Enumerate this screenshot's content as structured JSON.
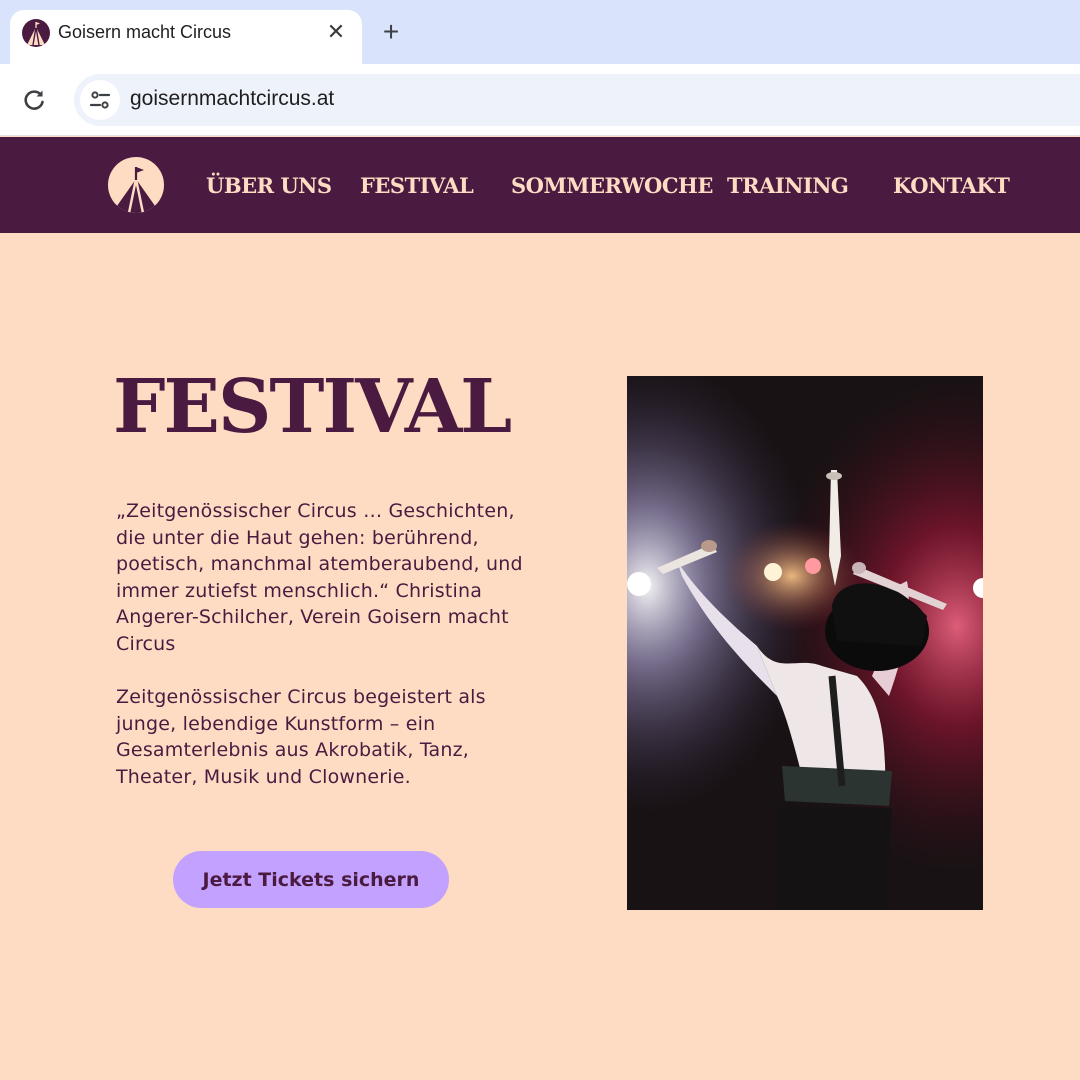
{
  "browser": {
    "tab": {
      "title": "Goisern macht Circus",
      "close": "✕"
    },
    "new_tab": "+",
    "url": "goisernmachtcircus.at"
  },
  "nav": {
    "items": [
      {
        "label": "ÜBER UNS"
      },
      {
        "label": "FESTIVAL"
      },
      {
        "label": "SOMMERWOCHE"
      },
      {
        "label": "TRAINING"
      },
      {
        "label": "KONTAKT"
      }
    ]
  },
  "main": {
    "headline": "FESTIVAL",
    "paragraphs": [
      "„Zeitgenössischer Circus … Geschichten, die unter die Haut gehen: berührend, poetisch, manchmal atem­beraubend, und immer zutiefst men­schlich.“ Christina Angerer-Schilcher, Verein Goisern macht Circus",
      "Zeitgenössischer Circus begeistert als junge, lebendige Kunstform – ein Gesamterlebnis aus Akrobatik, Tanz, Theater, Musik und Clownerie."
    ],
    "cta_label": "Jetzt Tickets sichern"
  },
  "colors": {
    "brand_purple": "#4b1a40",
    "page_peach": "#fddcc3",
    "cta_lavender": "#c2a1ff",
    "browser_tabbar": "#d9e3fb"
  },
  "icons": {
    "favicon": "circus-tent-logo-icon",
    "reload": "reload-icon",
    "site_info": "tune-icon",
    "close": "close-icon",
    "new_tab": "plus-icon"
  }
}
